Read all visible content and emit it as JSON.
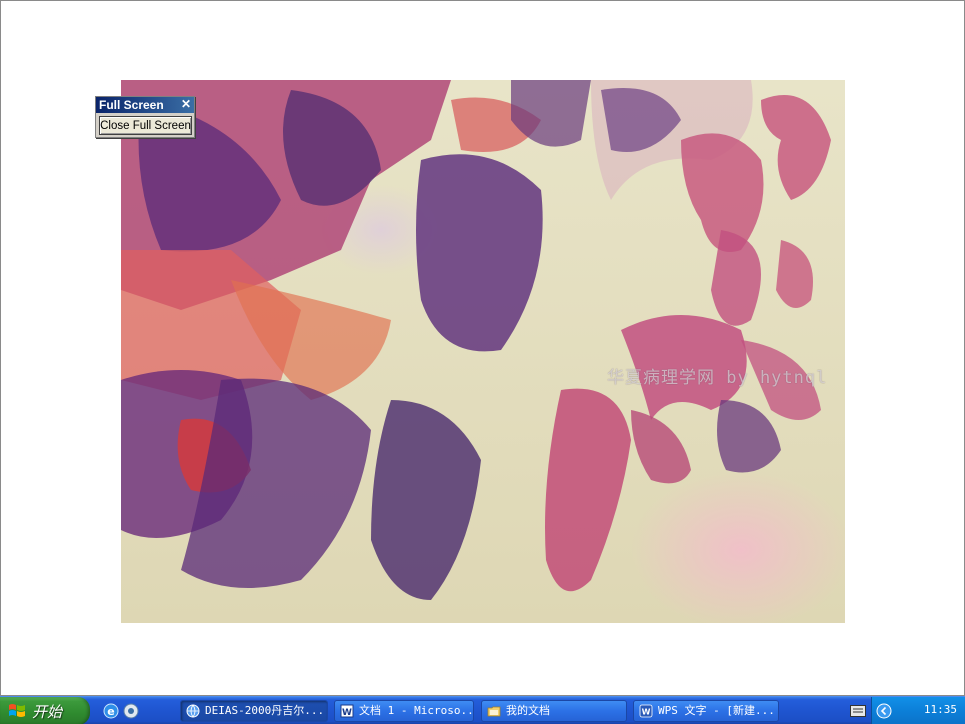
{
  "image": {
    "watermark": "华夏病理学网 by hytnql"
  },
  "fullscreen_toolbar": {
    "title": "Full Screen",
    "close_glyph": "✕",
    "close_button_label": "Close Full Screen"
  },
  "taskbar": {
    "start_label": "开始",
    "quick_launch": [
      {
        "icon": "internet-explorer-icon"
      },
      {
        "icon": "media-player-icon"
      }
    ],
    "tasks": [
      {
        "label": "DEIAS-2000丹吉尔...",
        "icon": "globe-app-icon",
        "active": true
      },
      {
        "label": "文档 1 - Microso...",
        "icon": "word-document-icon",
        "active": false
      },
      {
        "label": "我的文档",
        "icon": "folder-icon",
        "active": false
      },
      {
        "label": "WPS 文字 - [新建...",
        "icon": "wps-writer-icon",
        "active": false
      }
    ],
    "clock": "11:35",
    "colors": {
      "taskbar_blue": "#245edb",
      "start_green": "#3c9a3c",
      "tray_blue": "#0c7fd8"
    }
  }
}
